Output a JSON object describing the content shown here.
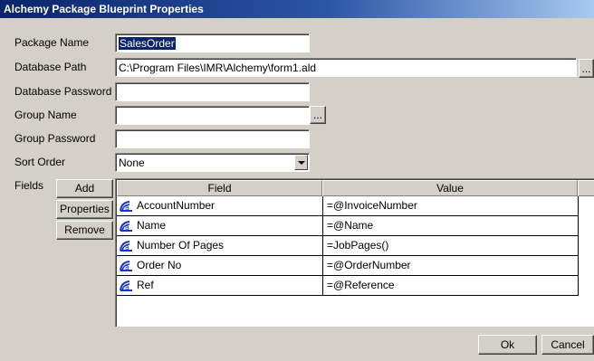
{
  "window": {
    "title": "Alchemy Package Blueprint Properties"
  },
  "form": {
    "package_name_label": "Package Name",
    "package_name_value": "SalesOrder",
    "database_path_label": "Database Path",
    "database_path_value": "C:\\Program Files\\IMR\\Alchemy\\form1.ald",
    "browse_label": "...",
    "database_password_label": "Database Password",
    "database_password_value": "",
    "group_name_label": "Group Name",
    "group_name_value": "",
    "group_password_label": "Group Password",
    "group_password_value": "",
    "sort_order_label": "Sort Order",
    "sort_order_value": "None"
  },
  "fields": {
    "label": "Fields",
    "add_button": "Add",
    "properties_button": "Properties",
    "remove_button": "Remove",
    "columns": [
      "Field",
      "Value"
    ],
    "rows": [
      {
        "field": "AccountNumber",
        "value": "=@InvoiceNumber"
      },
      {
        "field": "Name",
        "value": "=@Name"
      },
      {
        "field": "Number Of Pages",
        "value": "=JobPages()"
      },
      {
        "field": "Order No",
        "value": "=@OrderNumber"
      },
      {
        "field": "Ref",
        "value": "=@Reference"
      }
    ]
  },
  "footer": {
    "ok_button": "Ok",
    "cancel_button": "Cancel"
  },
  "icons": {
    "field_icon": "field-icon"
  },
  "colors": {
    "titlebar": "#0a246a",
    "selection": "#0a246a",
    "field_icon": "#1a33cc"
  }
}
